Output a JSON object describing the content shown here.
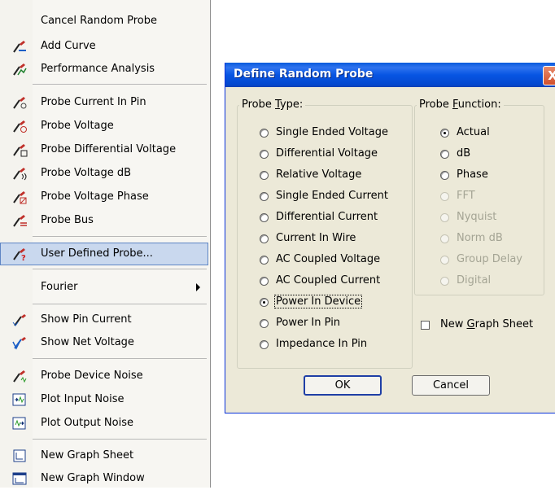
{
  "menu": {
    "items": [
      {
        "label": "Cancel Random Probe",
        "icon": "none"
      },
      {
        "label": "Add Curve",
        "icon": "add-curve-probe-icon"
      },
      {
        "label": "Performance Analysis",
        "icon": "performance-probe-icon"
      },
      {
        "label": "Probe Current In Pin",
        "icon": "probe-current-icon"
      },
      {
        "label": "Probe Voltage",
        "icon": "probe-voltage-icon"
      },
      {
        "label": "Probe Differential Voltage",
        "icon": "probe-diff-voltage-icon"
      },
      {
        "label": "Probe Voltage dB",
        "icon": "probe-voltage-db-icon"
      },
      {
        "label": "Probe Voltage Phase",
        "icon": "probe-voltage-phase-icon"
      },
      {
        "label": "Probe Bus",
        "icon": "probe-bus-icon"
      },
      {
        "label": "User Defined Probe...",
        "icon": "user-defined-probe-icon"
      },
      {
        "label": "Fourier",
        "icon": "none"
      },
      {
        "label": "Show Pin Current",
        "icon": "show-pin-current-icon"
      },
      {
        "label": "Show Net Voltage",
        "icon": "show-net-voltage-icon"
      },
      {
        "label": "Probe Device Noise",
        "icon": "probe-device-noise-icon"
      },
      {
        "label": "Plot Input Noise",
        "icon": "plot-input-noise-icon"
      },
      {
        "label": "Plot Output Noise",
        "icon": "plot-output-noise-icon"
      },
      {
        "label": "New Graph Sheet",
        "icon": "new-graph-sheet-icon"
      },
      {
        "label": "New Graph Window",
        "icon": "new-graph-window-icon"
      }
    ]
  },
  "dialog": {
    "title": "Define Random Probe",
    "close_glyph": "X",
    "probe_type": {
      "legend_pre": "Probe ",
      "legend_key": "T",
      "legend_post": "ype:",
      "options": [
        "Single Ended Voltage",
        "Differential Voltage",
        "Relative Voltage",
        "Single Ended Current",
        "Differential Current",
        "Current In Wire",
        "AC Coupled Voltage",
        "AC Coupled Current",
        "Power In Device",
        "Power In Pin",
        "Impedance In Pin"
      ],
      "selected": "Power In Device"
    },
    "probe_function": {
      "legend_pre": "Probe ",
      "legend_key": "F",
      "legend_post": "unction:",
      "options": [
        "Actual",
        "dB",
        "Phase",
        "FFT",
        "Nyquist",
        "Norm dB",
        "Group Delay",
        "Digital"
      ],
      "selected": "Actual"
    },
    "new_graph_sheet": {
      "pre": "New ",
      "key": "G",
      "post": "raph Sheet"
    },
    "ok_label": "OK",
    "cancel_label": "Cancel"
  }
}
